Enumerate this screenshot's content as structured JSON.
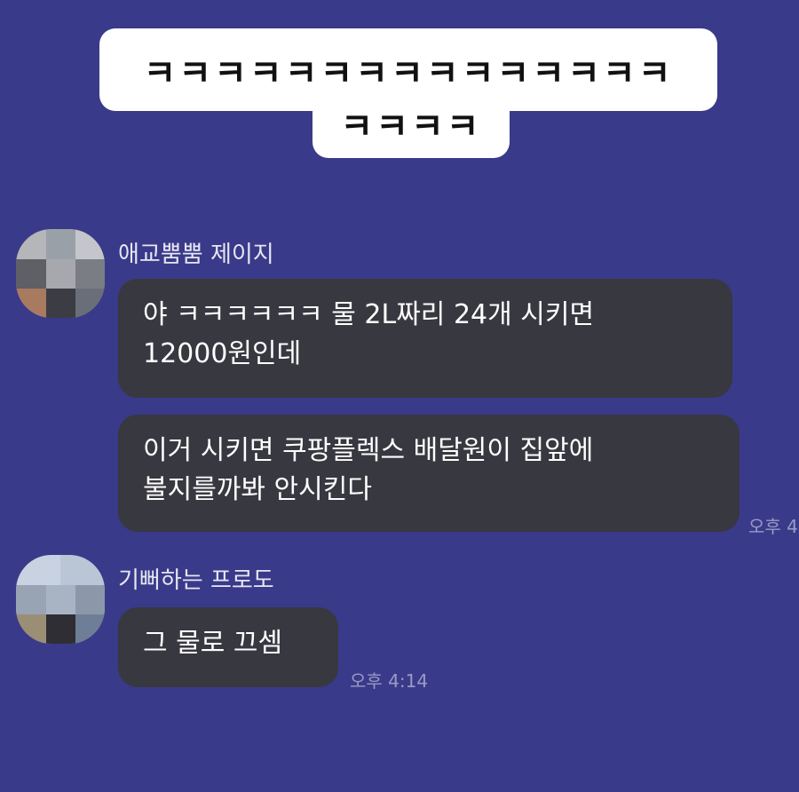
{
  "sent": {
    "lines": [
      "ㅋㅋㅋㅋㅋㅋㅋㅋㅋㅋㅋㅋㅋㅋㅋ",
      "ㅋㅋㅋㅋ"
    ]
  },
  "messages": [
    {
      "sender": "애교뿜뿜 제이지",
      "bubbles": [
        {
          "lines": [
            "야 ㅋㅋㅋㅋㅋㅋ 물 2L짜리 24개 시키면",
            "12000원인데"
          ]
        },
        {
          "lines": [
            "이거 시키면 쿠팡플렉스 배달원이 집앞에",
            "불지를까봐 안시킨다"
          ]
        }
      ],
      "time": "오후 4"
    },
    {
      "sender": "기뻐하는 프로도",
      "bubbles": [
        {
          "lines": [
            "그 물로 끄셈"
          ]
        }
      ],
      "time": "오후 4:14"
    }
  ]
}
